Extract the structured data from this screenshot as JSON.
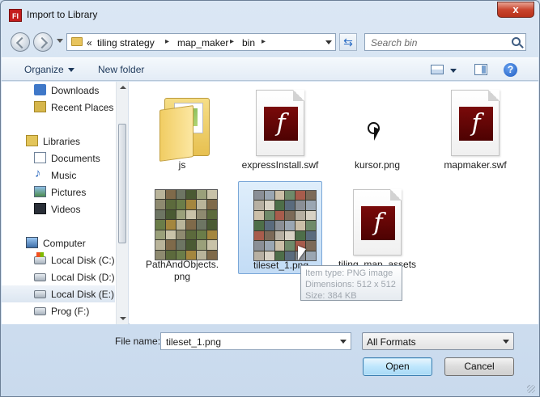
{
  "window": {
    "title": "Import to Library",
    "app_icon_text": "Fl",
    "close_label": "x"
  },
  "address_bar": {
    "overflow_marker": "«",
    "crumbs": [
      "tiling strategy",
      "map_maker",
      "bin"
    ],
    "separator": "▸"
  },
  "search": {
    "placeholder": "Search bin"
  },
  "toolbar": {
    "organize_label": "Organize",
    "new_folder_label": "New folder",
    "help_label": "?"
  },
  "nav_pane": {
    "items": [
      {
        "label": "Downloads",
        "icon": "downloads-icon"
      },
      {
        "label": "Recent Places",
        "icon": "recent-places-icon"
      },
      {
        "label": "Libraries",
        "icon": "libraries-icon",
        "section": true
      },
      {
        "label": "Documents",
        "icon": "documents-icon"
      },
      {
        "label": "Music",
        "icon": "music-icon"
      },
      {
        "label": "Pictures",
        "icon": "pictures-icon"
      },
      {
        "label": "Videos",
        "icon": "videos-icon"
      },
      {
        "label": "Computer",
        "icon": "computer-icon",
        "section": true
      },
      {
        "label": "Local Disk (C:)",
        "icon": "system-disk-icon"
      },
      {
        "label": "Local Disk (D:)",
        "icon": "disk-icon"
      },
      {
        "label": "Local Disk (E:)",
        "icon": "disk-icon",
        "selected": true
      },
      {
        "label": "Prog (F:)",
        "icon": "disk-icon"
      }
    ]
  },
  "files": [
    {
      "name": "js",
      "type": "folder"
    },
    {
      "name": "expressInstall.swf",
      "type": "swf"
    },
    {
      "name": "kursor.png",
      "type": "cursor"
    },
    {
      "name": "mapmaker.swf",
      "type": "swf"
    },
    {
      "name": "PathAndObjects.\npng",
      "type": "tileset"
    },
    {
      "name": "tileset_1.png",
      "type": "tileset",
      "selected": true
    },
    {
      "name": "tiling_map_assets\n.swf",
      "type": "swf"
    }
  ],
  "tooltip": {
    "line1": "Item type: PNG image",
    "line2": "Dimensions: 512 x 512",
    "line3": "Size: 384 KB"
  },
  "bottom": {
    "file_name_label": "File name:",
    "file_name_value": "tileset_1.png",
    "format_value": "All Formats",
    "open_label": "Open",
    "cancel_label": "Cancel"
  },
  "colors": {
    "selection": "#c3dcf5",
    "flash_logo": "#6a0606",
    "window_frame": "#c9daed"
  }
}
